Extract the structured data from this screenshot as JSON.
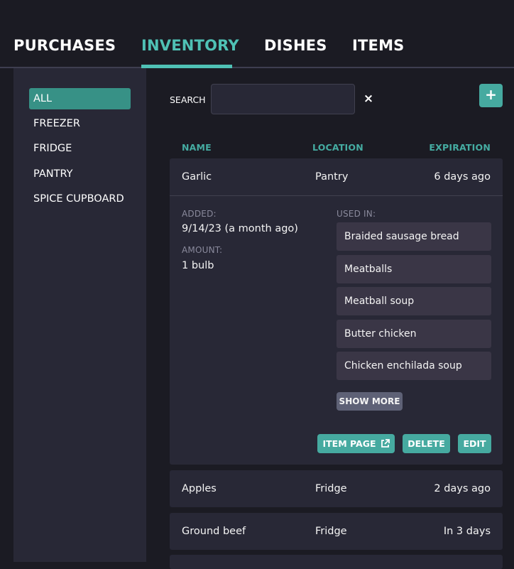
{
  "nav": {
    "tabs": [
      {
        "label": "PURCHASES",
        "active": false
      },
      {
        "label": "INVENTORY",
        "active": true
      },
      {
        "label": "DISHES",
        "active": false
      },
      {
        "label": "ITEMS",
        "active": false
      }
    ]
  },
  "sidebar": {
    "items": [
      {
        "label": "ALL",
        "active": true
      },
      {
        "label": "FREEZER",
        "active": false
      },
      {
        "label": "FRIDGE",
        "active": false
      },
      {
        "label": "PANTRY",
        "active": false
      },
      {
        "label": "SPICE CUPBOARD",
        "active": false
      }
    ]
  },
  "search": {
    "label": "SEARCH",
    "value": "",
    "placeholder": "",
    "clear_icon": "×",
    "add_icon": "+"
  },
  "table": {
    "columns": {
      "name": "NAME",
      "location": "LOCATION",
      "expiration": "EXPIRATION"
    },
    "rows": [
      {
        "name": "Garlic",
        "location": "Pantry",
        "expiration": "6 days ago",
        "expanded": true
      },
      {
        "name": "Apples",
        "location": "Fridge",
        "expiration": "2 days ago",
        "expanded": false
      },
      {
        "name": "Ground beef",
        "location": "Fridge",
        "expiration": "In 3 days",
        "expanded": false
      }
    ]
  },
  "detail": {
    "added_label": "ADDED:",
    "added_value": "9/14/23 (a month ago)",
    "amount_label": "AMOUNT:",
    "amount_value": "1 bulb",
    "used_in_label": "USED IN:",
    "used_in": [
      "Braided sausage bread",
      "Meatballs",
      "Meatball soup",
      "Butter chicken",
      "Chicken enchilada soup"
    ],
    "show_more_label": "SHOW MORE",
    "actions": {
      "item_page": "ITEM PAGE",
      "delete": "DELETE",
      "edit": "EDIT"
    }
  },
  "colors": {
    "accent": "#4fc1b5",
    "accent_button": "#46aaa0",
    "sidebar_active": "#379186",
    "background": "#1b1b23",
    "panel": "#282836"
  }
}
